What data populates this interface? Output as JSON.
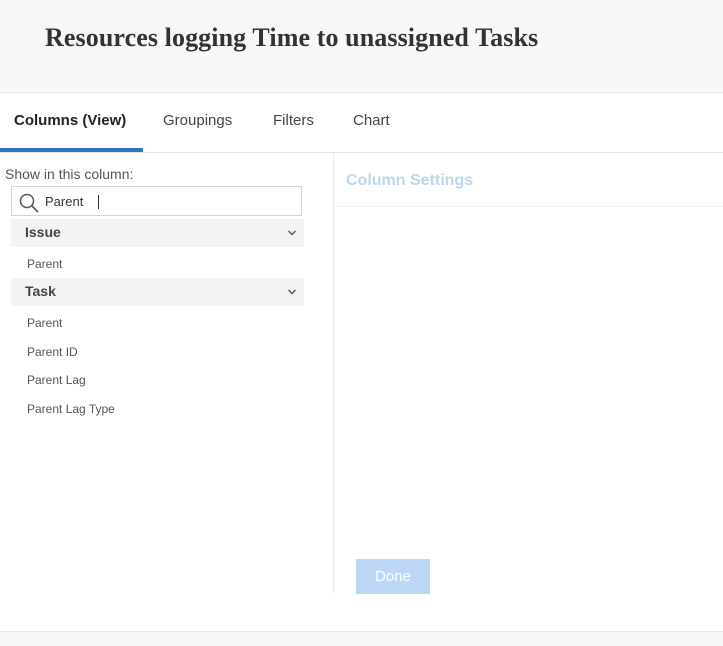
{
  "header": {
    "title": "Resources logging Time to unassigned Tasks"
  },
  "tabs": [
    {
      "label": "Columns (View)",
      "active": true
    },
    {
      "label": "Groupings",
      "active": false
    },
    {
      "label": "Filters",
      "active": false
    },
    {
      "label": "Chart",
      "active": false
    }
  ],
  "column_picker": {
    "label": "Show in this column:",
    "search": {
      "value": "Parent",
      "icon": "search-icon"
    },
    "groups": [
      {
        "label": "Issue",
        "icon": "chevron-down-icon",
        "items": [
          "Parent"
        ]
      },
      {
        "label": "Task",
        "icon": "chevron-down-icon",
        "items": [
          "Parent",
          "Parent ID",
          "Parent Lag",
          "Parent Lag Type"
        ]
      }
    ]
  },
  "settings": {
    "title": "Column Settings",
    "done_label": "Done"
  },
  "colors": {
    "accent": "#2f74c0",
    "settings_title": "#bdd6ee",
    "done_button": "#bcd7f5",
    "header_bg": "#f8f8f8"
  }
}
